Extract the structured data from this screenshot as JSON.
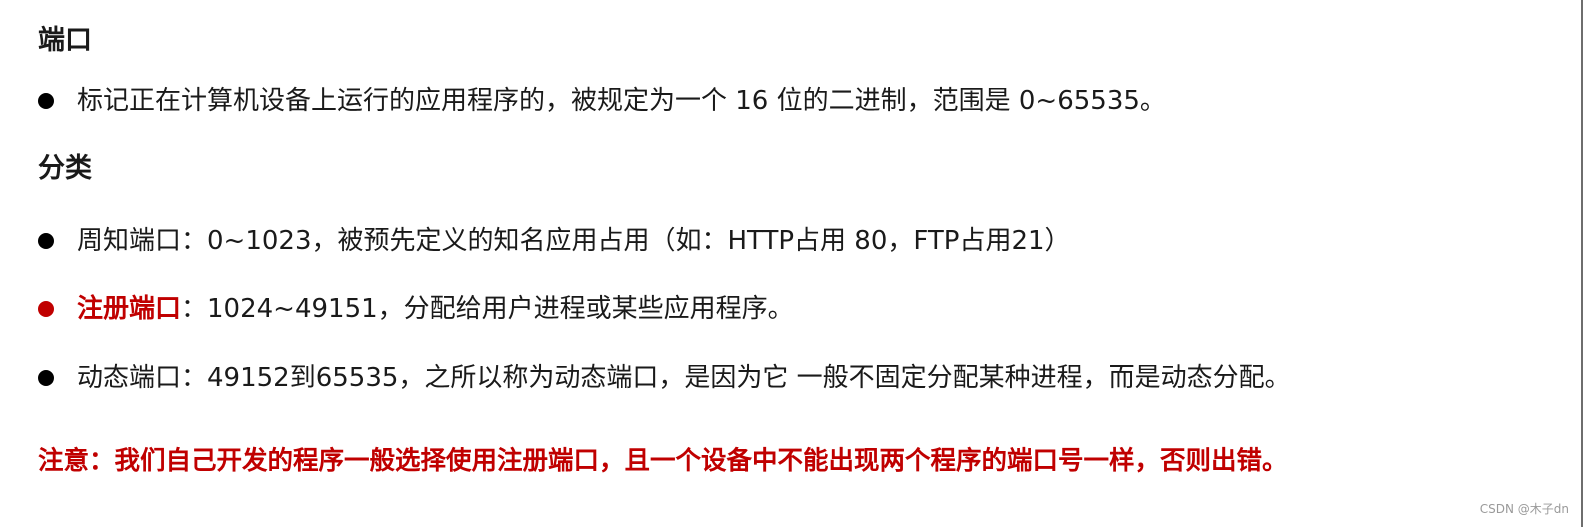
{
  "section_port": {
    "heading": "端口",
    "bullets": [
      "标记正在计算机设备上运行的应用程序的，被规定为一个 16 位的二进制，范围是 0~65535。"
    ]
  },
  "section_category": {
    "heading": "分类",
    "items": [
      {
        "label": "",
        "text": "周知端口：0~1023，被预先定义的知名应用占用（如：HTTP占用 80，FTP占用21）"
      },
      {
        "label": "注册端口",
        "text": "：1024~49151，分配给用户进程或某些应用程序。"
      },
      {
        "label": "",
        "text": "动态端口：49152到65535，之所以称为动态端口，是因为它 一般不固定分配某种进程，而是动态分配。"
      }
    ]
  },
  "note": "注意：我们自己开发的程序一般选择使用注册端口，且一个设备中不能出现两个程序的端口号一样，否则出错。",
  "watermark": "CSDN @木子dn",
  "colors": {
    "emphasis": "#c00000",
    "text": "#1a1a1a",
    "bullet": "#000000"
  }
}
